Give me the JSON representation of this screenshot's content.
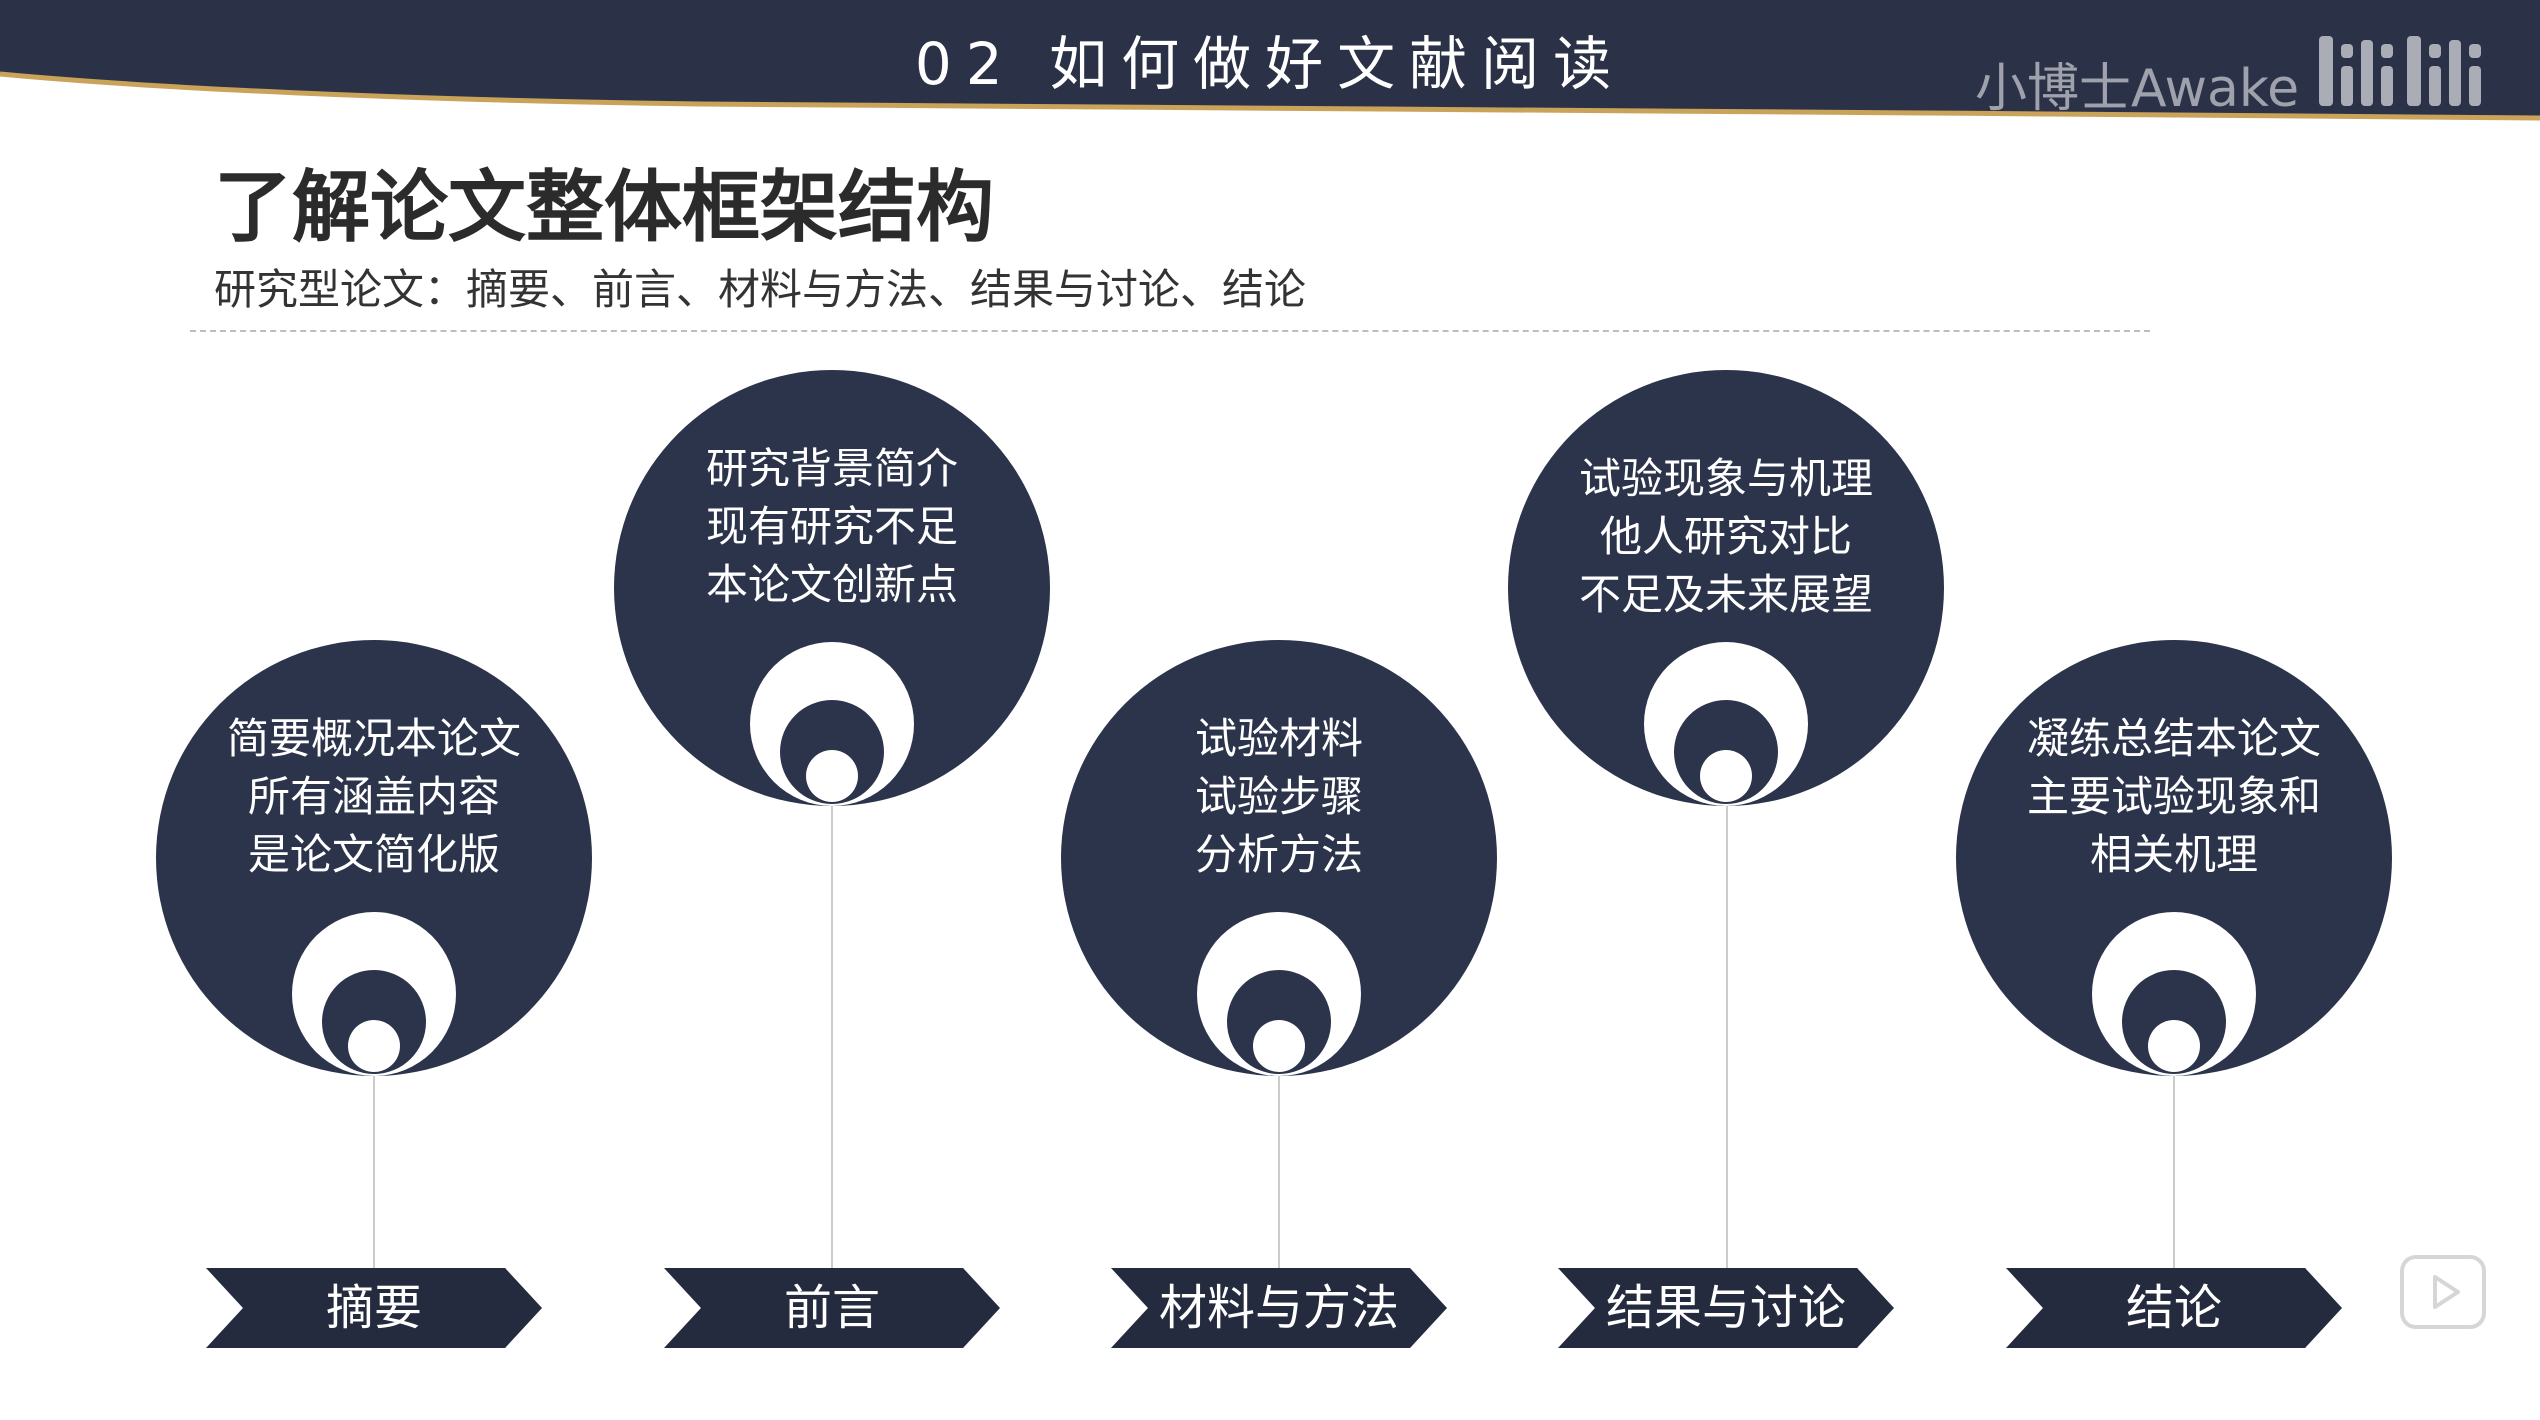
{
  "header": {
    "title": "02 如何做好文献阅读",
    "watermark": "小博士Awake",
    "brand_logo_icon": "bilibili-logo-icon",
    "bar_color": "#2b3247",
    "accent_color": "#c9a35a"
  },
  "slide": {
    "heading": "了解论文整体框架结构",
    "subtitle": "研究型论文：摘要、前言、材料与方法、结果与讨论、结论"
  },
  "sections": [
    {
      "label": "摘要",
      "lines": [
        "简要概况本论文",
        "所有涵盖内容",
        "是论文简化版"
      ]
    },
    {
      "label": "前言",
      "lines": [
        "研究背景简介",
        "现有研究不足",
        "本论文创新点"
      ]
    },
    {
      "label": "材料与方法",
      "lines": [
        "试验材料",
        "试验步骤",
        "分析方法"
      ]
    },
    {
      "label": "结果与讨论",
      "lines": [
        "试验现象与机理",
        "他人研究对比",
        "不足及未来展望"
      ]
    },
    {
      "label": "结论",
      "lines": [
        "凝练总结本论文",
        "主要试验现象和",
        "相关机理"
      ]
    }
  ],
  "colors": {
    "circle": "#2c344c",
    "tag": "#252b3e",
    "stem": "#cccccc"
  },
  "player": {
    "icon": "play-icon"
  }
}
